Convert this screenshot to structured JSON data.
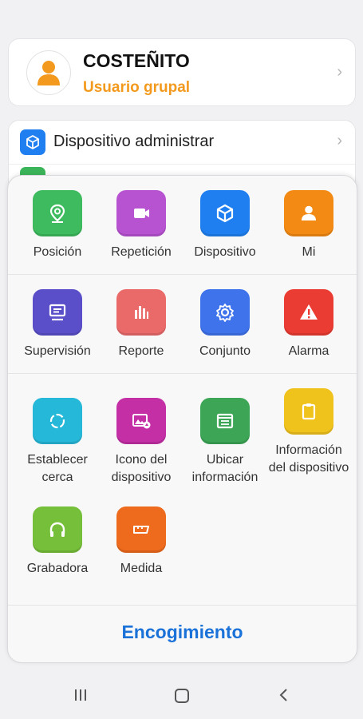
{
  "profile": {
    "name": "COSTEÑITO",
    "role": "Usuario grupal"
  },
  "device_row": {
    "label": "Dispositivo administrar"
  },
  "menu": {
    "rows": [
      [
        {
          "label": "Posición",
          "icon": "location-pin-icon",
          "color": "#3dbb5e"
        },
        {
          "label": "Repetición",
          "icon": "video-camera-icon",
          "color": "#b752d1"
        },
        {
          "label": "Dispositivo",
          "icon": "cube-icon",
          "color": "#1f7ff0"
        },
        {
          "label": "Mi",
          "icon": "user-icon",
          "color": "#f28a13"
        }
      ],
      [
        {
          "label": "Supervisión",
          "icon": "monitor-icon",
          "color": "#5a4fc9"
        },
        {
          "label": "Reporte",
          "icon": "bar-chart-icon",
          "color": "#ea6a6a"
        },
        {
          "label": "Conjunto",
          "icon": "gear-icon",
          "color": "#3f73ec"
        },
        {
          "label": "Alarma",
          "icon": "warning-icon",
          "color": "#ea3c32"
        }
      ],
      [
        {
          "label": "Establecer cerca",
          "icon": "fence-circle-icon",
          "color": "#26b8d8"
        },
        {
          "label": "Icono del dispositivo",
          "icon": "image-icon",
          "color": "#c42fa6"
        },
        {
          "label": "Ubicar información",
          "icon": "browser-window-icon",
          "color": "#3da656"
        },
        {
          "label": "Información del dispositivo",
          "icon": "clipboard-icon",
          "color": "#f0c21c"
        }
      ],
      [
        {
          "label": "Grabadora",
          "icon": "headphones-icon",
          "color": "#76bf3a"
        },
        {
          "label": "Medida",
          "icon": "ruler-icon",
          "color": "#ee6a1c"
        }
      ]
    ],
    "shrink_label": "Encogimiento"
  },
  "navbar": {
    "recents": "recents-icon",
    "home": "home-icon",
    "back": "back-icon"
  }
}
